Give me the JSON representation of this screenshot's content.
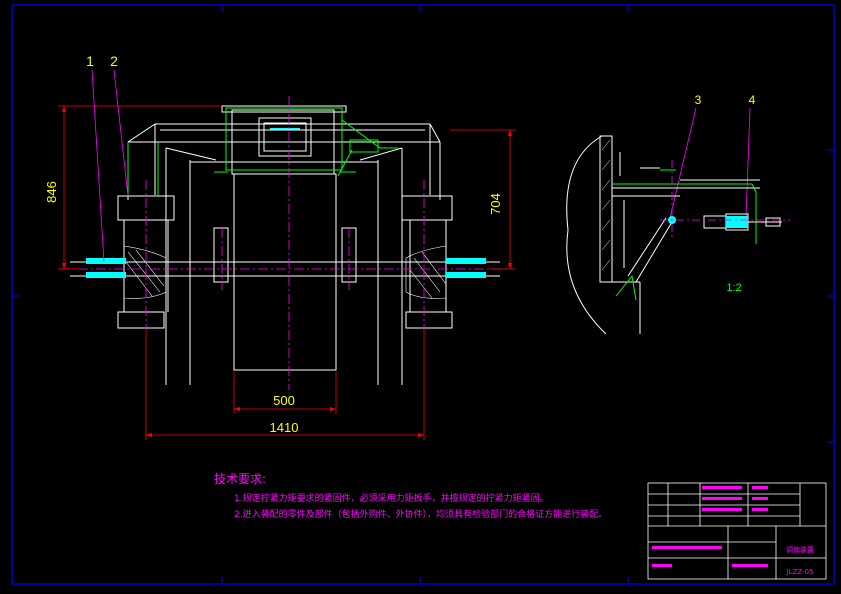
{
  "callouts": {
    "p1": "1",
    "p2": "2",
    "p3": "3",
    "p4": "4"
  },
  "dimensions": {
    "height_total": "846",
    "height_right": "704",
    "width_inner": "500",
    "width_total": "1410"
  },
  "scale": "1:2",
  "notes": {
    "title": "技术要求:",
    "line1": "1.规定拧紧力矩要求的紧固件，必须采用力矩扳手，并按规定的拧紧力矩紧固。",
    "line2": "2.进入装配的零件及部件（包括外购件、外协件），均须具有检验部门的合格证方能进行装配。"
  },
  "title_block": {
    "name": "调偏装置",
    "drawing_no": "JLZZ-05"
  },
  "colors": {
    "border": "#0000ff",
    "outline": "#ffffff",
    "centerline": "#ff00ff",
    "dimension": "#ff0000",
    "callout": "#ffff00",
    "hidden": "#00ff00",
    "fill": "#00ffff"
  }
}
